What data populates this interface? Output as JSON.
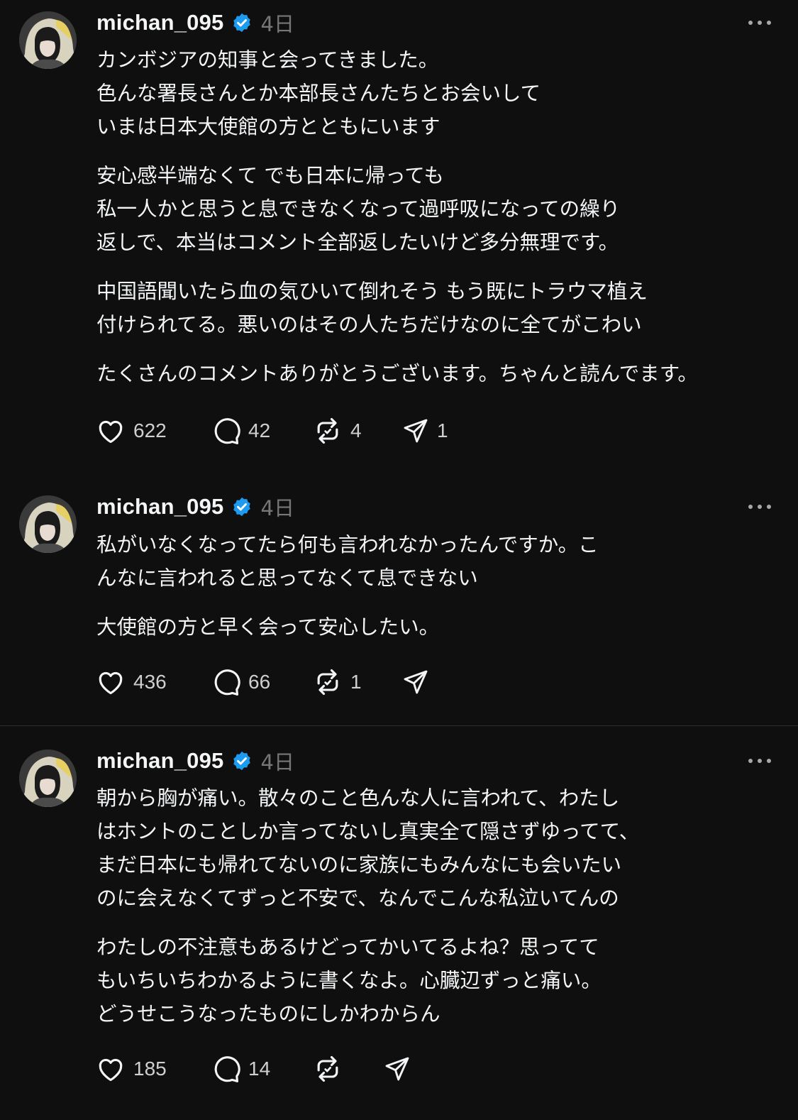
{
  "colors": {
    "background": "#0f0f0f",
    "text": "#f3f5f7",
    "muted": "#777777",
    "verified": "#1d9bf0",
    "divider": "#2b2b2b"
  },
  "icons": {
    "avatar": "avatar-image",
    "verified": "verified-badge-icon",
    "more": "more-options-icon",
    "like": "heart-icon",
    "reply": "comment-bubble-icon",
    "repost": "repost-icon",
    "share": "send-icon"
  },
  "posts": [
    {
      "username": "michan_095",
      "time": "4日",
      "paragraphs": [
        "カンボジアの知事と会ってきました。\n色んな署長さんとか本部長さんたちとお会いして\nいまは日本大使館の方とともにいます",
        "安心感半端なくて でも日本に帰っても\n私一人かと思うと息できなくなって過呼吸になっての繰り\n返しで、本当はコメント全部返したいけど多分無理です。",
        "中国語聞いたら血の気ひいて倒れそう もう既にトラウマ植え\n付けられてる。悪いのはその人たちだけなのに全てがこわい",
        "たくさんのコメントありがとうございます。ちゃんと読んでます。"
      ],
      "likes": "622",
      "replies": "42",
      "reposts": "4",
      "shares": "1"
    },
    {
      "username": "michan_095",
      "time": "4日",
      "paragraphs": [
        "私がいなくなってたら何も言われなかったんですか。こ\nんなに言われると思ってなくて息できない",
        "大使館の方と早く会って安心したい。"
      ],
      "likes": "436",
      "replies": "66",
      "reposts": "1",
      "shares": ""
    },
    {
      "username": "michan_095",
      "time": "4日",
      "paragraphs": [
        "朝から胸が痛い。散々のこと色んな人に言われて、わたし\nはホントのことしか言ってないし真実全て隠さずゆってて、\nまだ日本にも帰れてないのに家族にもみんなにも会いたい\nのに会えなくてずっと不安で、なんでこんな私泣いてんの",
        "わたしの不注意もあるけどってかいてるよね？思ってて\nもいちいちわかるように書くなよ。心臓辺ずっと痛い。\nどうせこうなったものにしかわからん"
      ],
      "likes": "185",
      "replies": "14",
      "reposts": "",
      "shares": ""
    }
  ]
}
